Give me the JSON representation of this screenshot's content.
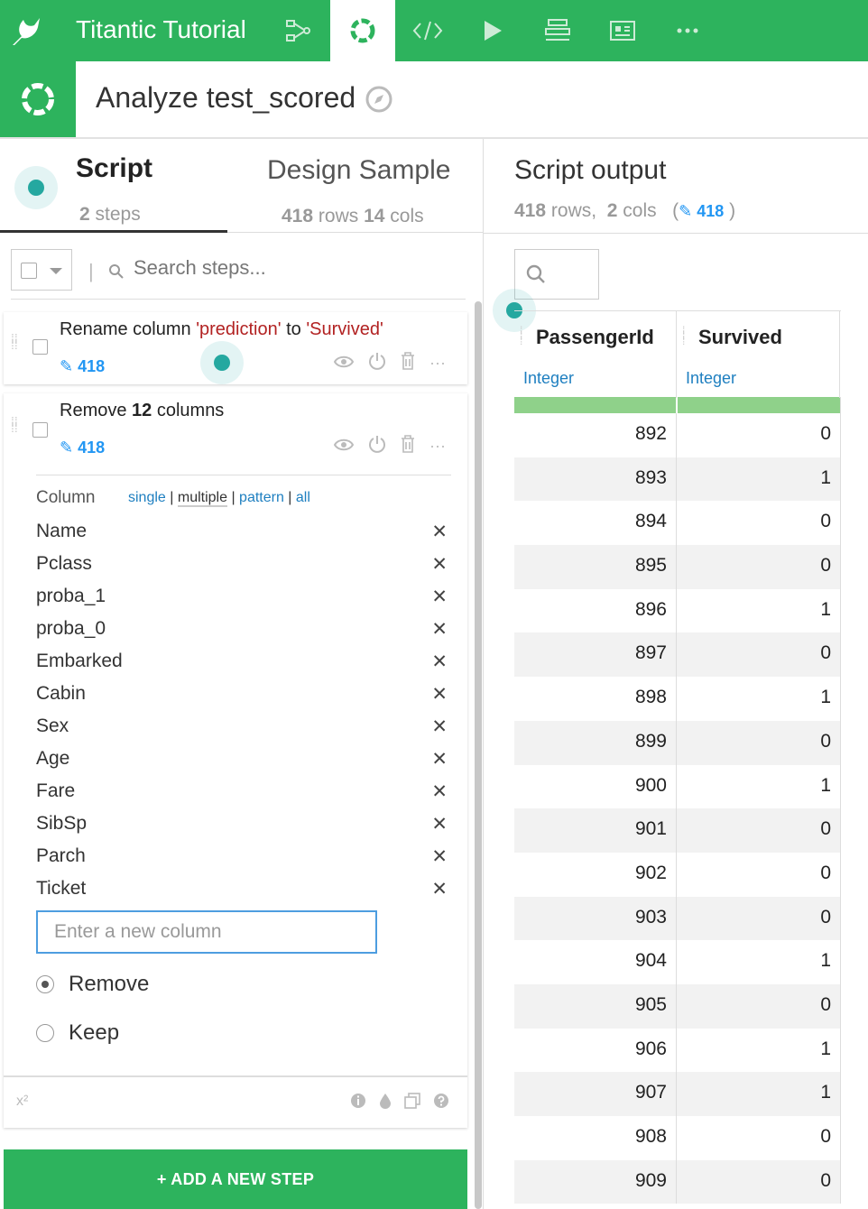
{
  "app": {
    "project_title": "Titantic Tutorial"
  },
  "recipe": {
    "title": "Analyze test_scored"
  },
  "tabs": {
    "script": {
      "label": "Script",
      "steps_count": "2",
      "steps_label": "steps"
    },
    "design": {
      "label": "Design Sample",
      "rows": "418",
      "rows_label": "rows",
      "cols": "14",
      "cols_label": "cols"
    }
  },
  "steps_toolbar": {
    "search_placeholder": "Search steps..."
  },
  "steps": [
    {
      "prefix": "Rename column ",
      "from": "'prediction'",
      "mid": " to ",
      "to": "'Survived'",
      "count": "418"
    },
    {
      "prefix": "Remove ",
      "num": "12",
      "suffix": " columns",
      "count": "418",
      "column_label": "Column",
      "modes": [
        "single",
        "multiple",
        "pattern",
        "all"
      ],
      "columns": [
        "Name",
        "Pclass",
        "proba_1",
        "proba_0",
        "Embarked",
        "Cabin",
        "Sex",
        "Age",
        "Fare",
        "SibSp",
        "Parch",
        "Ticket"
      ],
      "new_column_placeholder": "Enter a new column",
      "options": [
        {
          "label": "Remove",
          "selected": true
        },
        {
          "label": "Keep",
          "selected": false
        }
      ],
      "footer_formula": "x²"
    }
  ],
  "add_step": {
    "label": "+ ADD A NEW STEP"
  },
  "output": {
    "title": "Script output",
    "rows": "418",
    "rows_label": "rows,",
    "cols": "2",
    "cols_label": "cols",
    "open_paren": "(",
    "badge": "418",
    "close_paren": ")"
  },
  "table": {
    "columns": [
      {
        "name": "PassengerId",
        "type": "Integer"
      },
      {
        "name": "Survived",
        "type": "Integer"
      }
    ],
    "rows": [
      [
        "892",
        "0"
      ],
      [
        "893",
        "1"
      ],
      [
        "894",
        "0"
      ],
      [
        "895",
        "0"
      ],
      [
        "896",
        "1"
      ],
      [
        "897",
        "0"
      ],
      [
        "898",
        "1"
      ],
      [
        "899",
        "0"
      ],
      [
        "900",
        "1"
      ],
      [
        "901",
        "0"
      ],
      [
        "902",
        "0"
      ],
      [
        "903",
        "0"
      ],
      [
        "904",
        "1"
      ],
      [
        "905",
        "0"
      ],
      [
        "906",
        "1"
      ],
      [
        "907",
        "1"
      ],
      [
        "908",
        "0"
      ],
      [
        "909",
        "0"
      ]
    ]
  },
  "colors": {
    "brand_green": "#2db35d",
    "link_blue": "#2196f3",
    "quote_red": "#b22222",
    "hint_teal": "#25a8a0"
  }
}
